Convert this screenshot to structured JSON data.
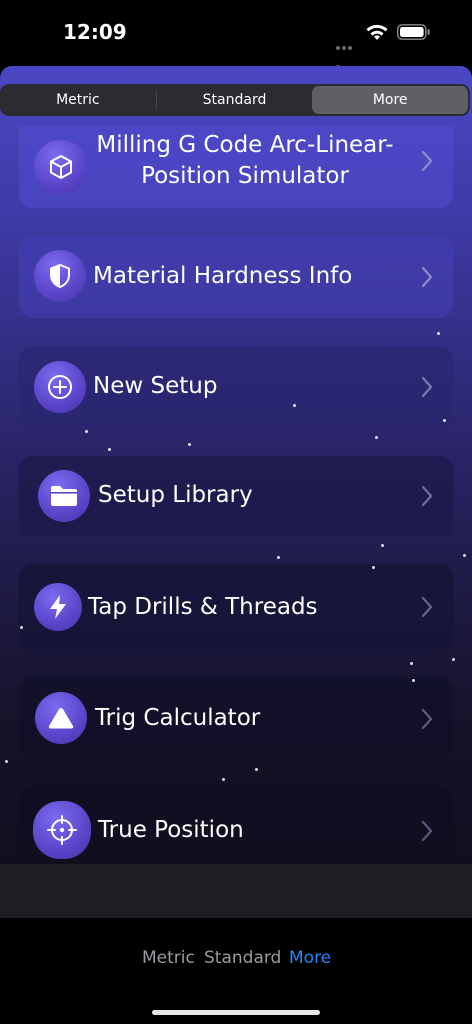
{
  "status": {
    "time": "12:09"
  },
  "segmented": {
    "items": [
      "Metric",
      "Standard",
      "More"
    ],
    "active_index": 2
  },
  "list": {
    "items": [
      {
        "label_line1": "Milling G Code Arc-Linear-",
        "label_line2": "Position Simulator",
        "icon": "cube-icon"
      },
      {
        "label": "Material Hardness Info",
        "icon": "shield-icon"
      },
      {
        "label": "New Setup",
        "icon": "plus-circle-icon"
      },
      {
        "label": "Setup Library",
        "icon": "folder-icon"
      },
      {
        "label": "Tap Drills & Threads",
        "icon": "bolt-icon"
      },
      {
        "label": "Trig Calculator",
        "icon": "triangle-icon"
      },
      {
        "label": "True Position",
        "icon": "crosshair-icon"
      }
    ]
  },
  "tabbar": {
    "items": [
      "Metric",
      "Standard",
      "More"
    ],
    "active_index": 2
  },
  "colors": {
    "accent": "#1e88ff",
    "tab_inactive": "#9a9aa0",
    "row_bg": "#2a2560"
  }
}
